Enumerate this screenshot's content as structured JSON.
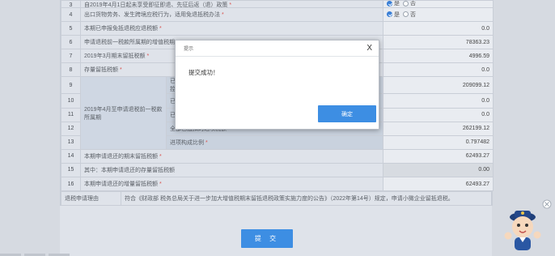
{
  "form": {
    "rows": [
      {
        "num": "3",
        "label": "自2019年4月1日起未享受即征即退、先征后返（退）政策",
        "type": "radio",
        "required": true
      },
      {
        "num": "4",
        "label": "出口货物劳务、发生跨境应税行为，适用免退抵税办法",
        "type": "radio",
        "required": true
      },
      {
        "num": "5",
        "label": "本期已申报免抵退税应退税额",
        "value": "0.0",
        "required": true
      },
      {
        "num": "6",
        "label": "申请退税前一税款所属期的增值税期",
        "value": "78363.23",
        "required": false
      },
      {
        "num": "7",
        "label": "2019年3月期末留抵税额",
        "value": "4996.59",
        "required": true
      },
      {
        "num": "8",
        "label": "存量留抵税额",
        "value": "0.0",
        "required": true
      },
      {
        "num": "9",
        "sub_label": "已取",
        "sub_label2": "控",
        "value": "209099.12"
      },
      {
        "num": "10",
        "sub_label": "已取",
        "value": "0.0"
      },
      {
        "num": "11",
        "sub_label": "已取",
        "value": "0.0"
      },
      {
        "num": "12",
        "sub_label": "全部已抵扣的进项税额",
        "value": "262199.12",
        "required": true
      },
      {
        "num": "13",
        "sub_label": "进项构成比例",
        "value": "0.797482",
        "required": true
      },
      {
        "num": "14",
        "label": "本期申请退还的期末留抵税额",
        "value": "62493.27",
        "required": true
      },
      {
        "num": "15",
        "label": "其中：本期申请退还的存量留抵税额",
        "value": "0.00",
        "required": false,
        "gray": true
      },
      {
        "num": "16",
        "label": "本期申请退还的增量留抵税额",
        "value": "62493.27",
        "required": true
      }
    ],
    "group_label": "2019年4月至申请退税前一税款所属期",
    "radio_yes": "是",
    "radio_no": "否",
    "reason_label": "退税申请理由",
    "reason_text": "符合《财政部 税务总局关于进一步加大增值税期末留抵退税政策实施力度的公告》（2022年第14号）规定，申请小微企业留抵退税。",
    "submit_label": "提 交"
  },
  "dialog": {
    "title": "提示",
    "close": "X",
    "message": "提交成功！",
    "ok_label": "确定"
  },
  "colors": {
    "accent": "#3d8ee3",
    "required": "#d9534f"
  }
}
